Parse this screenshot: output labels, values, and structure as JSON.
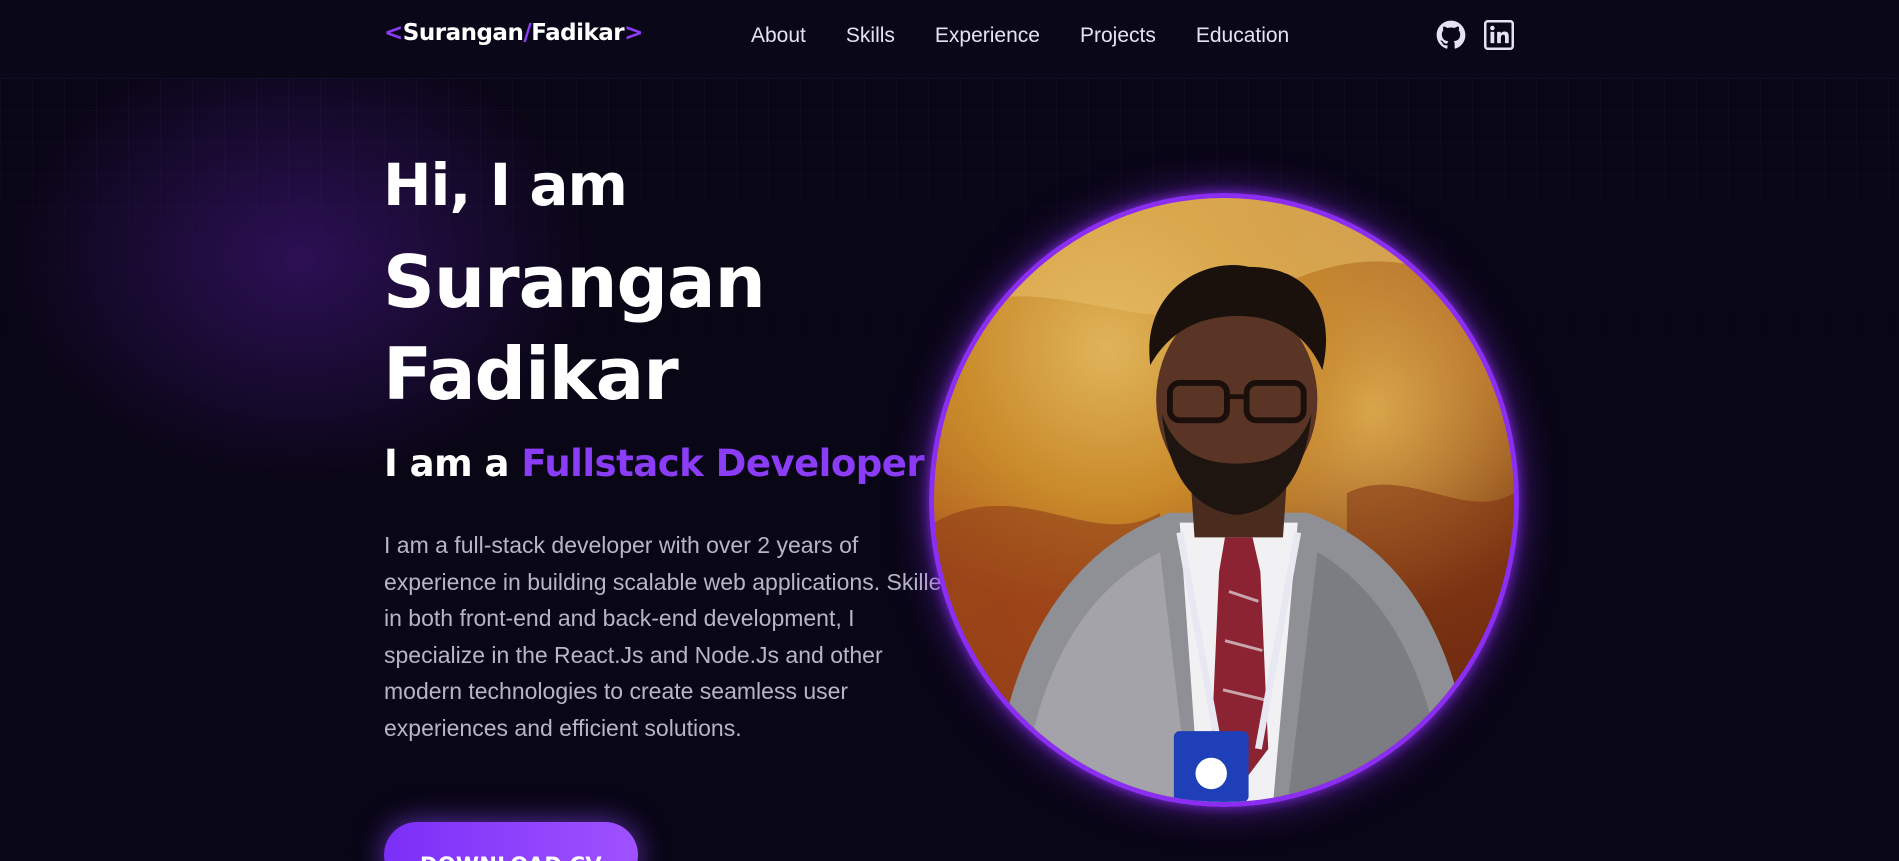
{
  "header": {
    "logo": {
      "bracket_open": "<",
      "first_name": "Surangan",
      "slash": "/",
      "last_name": "Fadikar",
      "bracket_close": ">"
    },
    "nav": [
      {
        "label": "About"
      },
      {
        "label": "Skills"
      },
      {
        "label": "Experience"
      },
      {
        "label": "Projects"
      },
      {
        "label": "Education"
      }
    ],
    "social_icons": [
      "github-icon",
      "linkedin-icon"
    ]
  },
  "hero": {
    "greeting": "Hi, I am",
    "name_line1": "Surangan",
    "name_line2": "Fadikar",
    "role_prefix": "I am a ",
    "role_title": "Fullstack Developer",
    "bio": "I am a full-stack developer with over 2 years of experience in building scalable web applications. Skilled in both front-end and back-end development, I specialize in the React.Js and Node.Js and other modern technologies to create seamless user experiences and efficient solutions.",
    "download_button": "DOWNLOAD CV"
  },
  "colors": {
    "background": "#090616",
    "accent": "#8b3cf7",
    "photo_border": "#8b2ef2",
    "body_text": "#b9b5c9"
  }
}
